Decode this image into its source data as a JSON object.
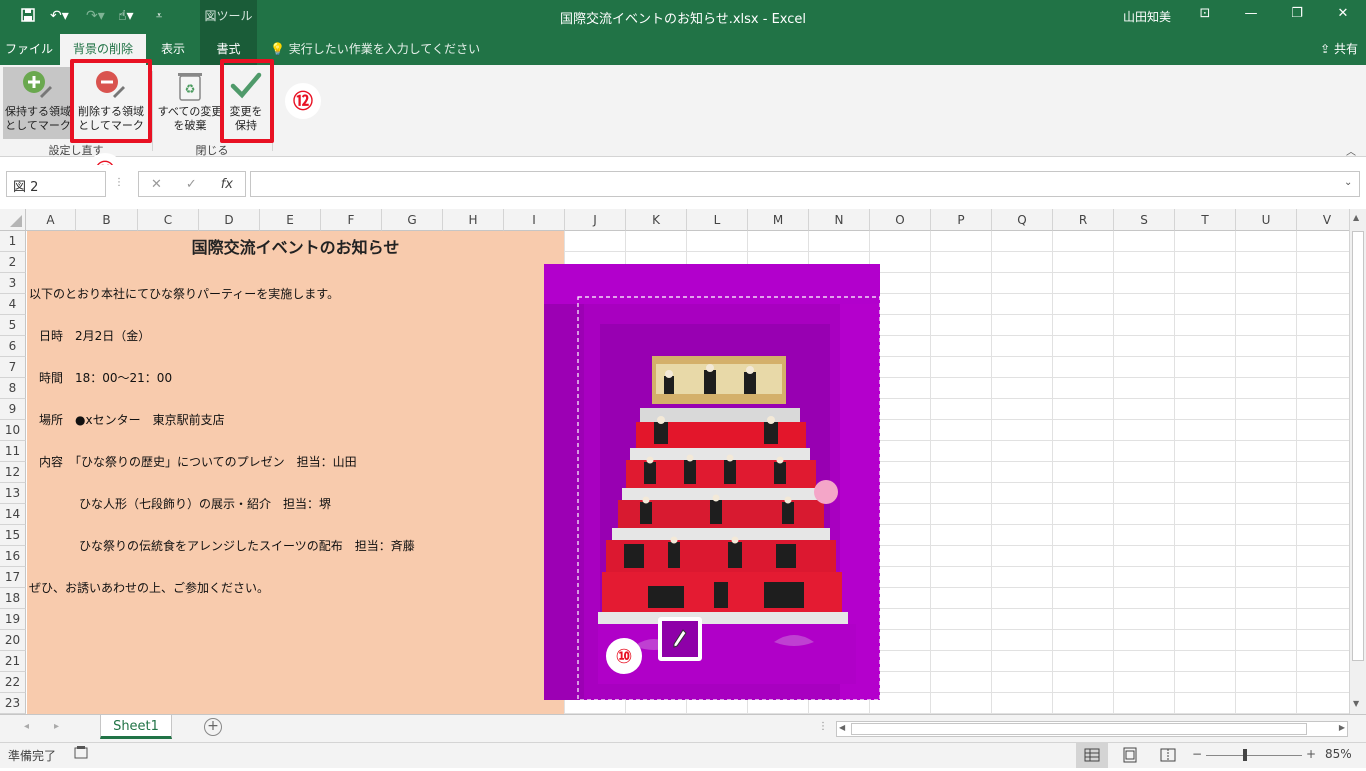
{
  "window": {
    "title": "国際交流イベントのお知らせ.xlsx  -  Excel",
    "context_tool": "図ツール",
    "user": "山田知美",
    "controls": [
      "⊡",
      "—",
      "❐",
      "✕"
    ]
  },
  "tabs": [
    {
      "label": "ファイル"
    },
    {
      "label": "背景の削除"
    },
    {
      "label": "表示"
    },
    {
      "label": "書式"
    }
  ],
  "tell_me": "実行したい作業を入力してください",
  "share": "共有",
  "ribbon": {
    "keep": {
      "line1": "保持する領域",
      "line2": "としてマーク"
    },
    "remove": {
      "line1": "削除する領域",
      "line2": "としてマーク"
    },
    "discard": {
      "line1": "すべての変更",
      "line2": "を破棄"
    },
    "save": {
      "line1": "変更を",
      "line2": "保持"
    },
    "group1": "設定し直す",
    "group2": "閉じる"
  },
  "callouts": {
    "n10": "⑩",
    "n11": "⑪",
    "n12": "⑫"
  },
  "formula_bar": {
    "name_box": "図 2",
    "cancel": "✕",
    "enter": "✓",
    "fx": "fx",
    "value": ""
  },
  "columns": [
    "A",
    "B",
    "C",
    "D",
    "E",
    "F",
    "G",
    "H",
    "I",
    "J",
    "K",
    "L",
    "M",
    "N",
    "O",
    "P",
    "Q",
    "R",
    "S",
    "T",
    "U",
    "V"
  ],
  "rows": [
    "1",
    "2",
    "3",
    "4",
    "5",
    "6",
    "7",
    "8",
    "9",
    "10",
    "11",
    "12",
    "13",
    "14",
    "15",
    "16",
    "17",
    "18",
    "19",
    "20",
    "21",
    "22",
    "23"
  ],
  "cells": {
    "r1": "国際交流イベントのお知らせ",
    "r3": "以下のとおり本社にてひな祭りパーティーを実施します。",
    "r5": "日時　2月2日（金）",
    "r7": "時間　18：00〜21：00",
    "r9": "場所　●ⅹセンター　東京駅前支店",
    "r11": "内容　「ひな祭りの歴史」についてのプレゼン　担当：山田",
    "r13": "ひな人形（七段飾り）の展示・紹介　担当：堺",
    "r15": "ひな祭りの伝統食をアレンジしたスイーツの配布　担当：斉藤",
    "r17": "ぜひ、お誘いあわせの上、ご参加ください。"
  },
  "sheet_tab": "Sheet1",
  "status": {
    "ready": "準備完了",
    "zoom": "85%"
  },
  "colors": {
    "excel_green": "#217346",
    "callout_red": "#e81123",
    "peach": "#f8cbad",
    "magenta": "#b000c8"
  }
}
